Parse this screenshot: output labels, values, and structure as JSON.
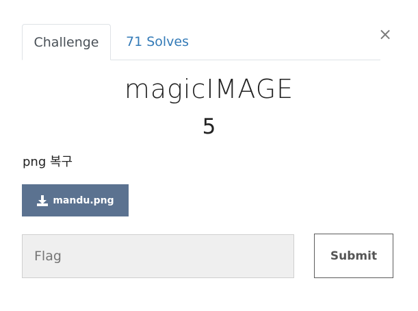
{
  "tabs": {
    "challenge_label": "Challenge",
    "solves_label": "71 Solves"
  },
  "close": {
    "symbol": "×"
  },
  "challenge": {
    "name": "magicIMAGE",
    "points": "5",
    "description": "png 복구"
  },
  "files": [
    {
      "name": "mandu.png",
      "icon": "download-icon"
    }
  ],
  "submission": {
    "placeholder": "Flag",
    "value": "",
    "submit_label": "Submit"
  },
  "colors": {
    "link": "#337ab7",
    "download_button": "#5b7290",
    "input_background": "#efefef"
  }
}
